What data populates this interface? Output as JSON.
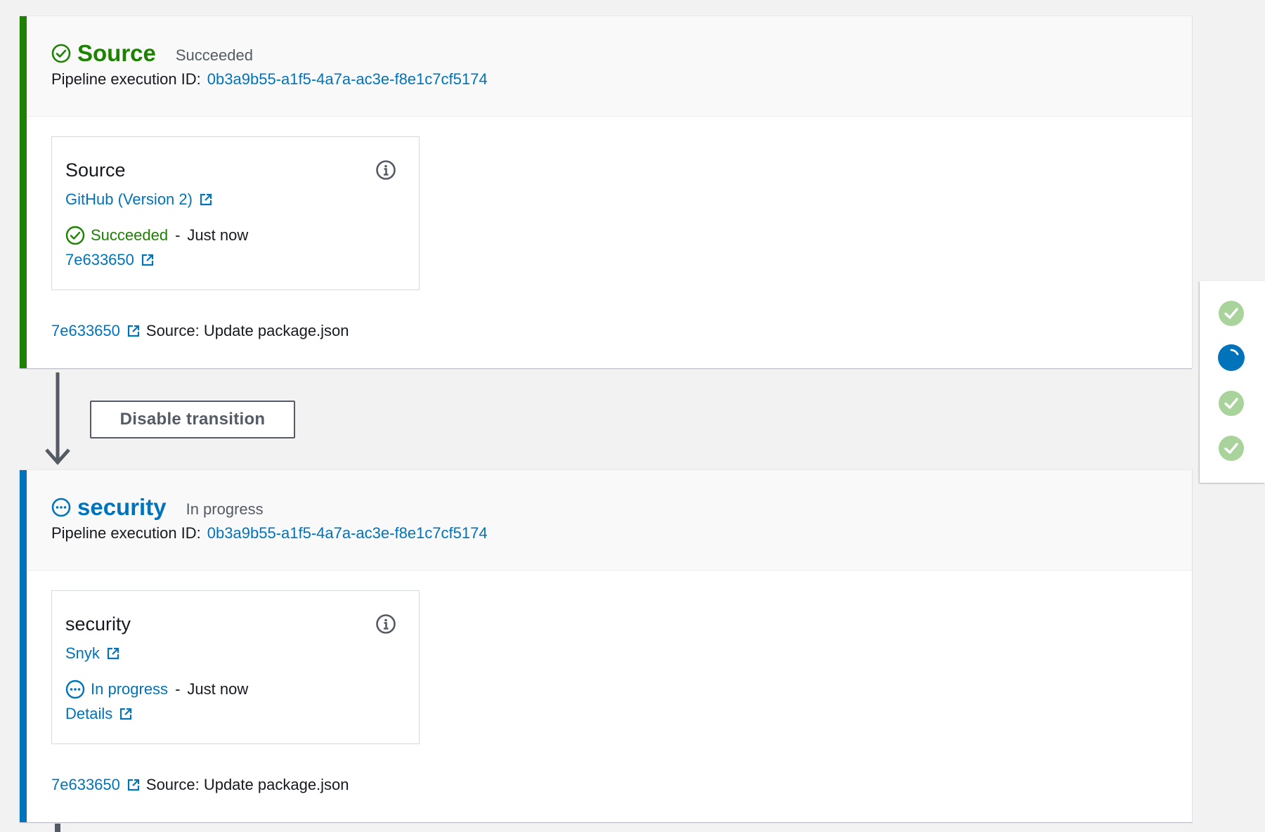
{
  "stages": [
    {
      "name": "Source",
      "status": "Succeeded",
      "execution_label": "Pipeline execution ID:",
      "execution_id": "0b3a9b55-a1f5-4a7a-ac3e-f8e1c7cf5174",
      "action": {
        "title": "Source",
        "provider": "GitHub (Version 2)",
        "status": "Succeeded",
        "separator": "-",
        "time": "Just now",
        "link": "7e633650"
      },
      "commit": {
        "id": "7e633650",
        "message": "Source: Update package.json"
      }
    },
    {
      "name": "security",
      "status": "In progress",
      "execution_label": "Pipeline execution ID:",
      "execution_id": "0b3a9b55-a1f5-4a7a-ac3e-f8e1c7cf5174",
      "action": {
        "title": "security",
        "provider": "Snyk",
        "status": "In progress",
        "separator": "-",
        "time": "Just now",
        "link": "Details"
      },
      "commit": {
        "id": "7e633650",
        "message": "Source: Update package.json"
      }
    }
  ],
  "transition": {
    "button_label": "Disable transition"
  },
  "side_steps": [
    "succeeded",
    "in-progress",
    "succeeded",
    "succeeded"
  ],
  "colors": {
    "success": "#1d8102",
    "progress": "#0073bb",
    "link": "#0073bb",
    "step_success": "#a8d39a"
  }
}
